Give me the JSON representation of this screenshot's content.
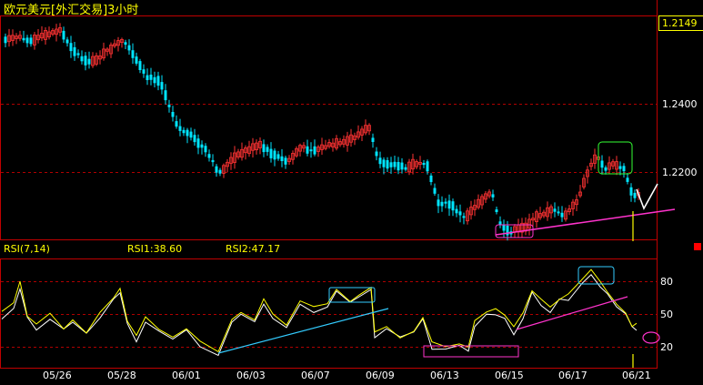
{
  "header": {
    "title": "欧元美元[外汇交易]3小时"
  },
  "price_axis": {
    "current_price": "1.2149",
    "ticks": [
      "1.2400",
      "1.2200"
    ]
  },
  "indicator": {
    "name": "RSI(7,14)",
    "rsi1": "RSI1:38.60",
    "rsi2": "RSI2:47.17",
    "ticks": [
      "80",
      "50",
      "20"
    ]
  },
  "dates": [
    "05/26",
    "05/28",
    "06/01",
    "06/03",
    "06/07",
    "06/09",
    "06/13",
    "06/15",
    "06/17",
    "06/21"
  ],
  "colors": {
    "up_candle": "#ff3333",
    "down_candle": "#00e5ff",
    "grid": "#b00000",
    "rsi1_line": "#ffffff",
    "rsi2_line": "#ffff00",
    "trendline_pink": "#ff33cc",
    "trendline_cyan": "#33ccff"
  }
}
